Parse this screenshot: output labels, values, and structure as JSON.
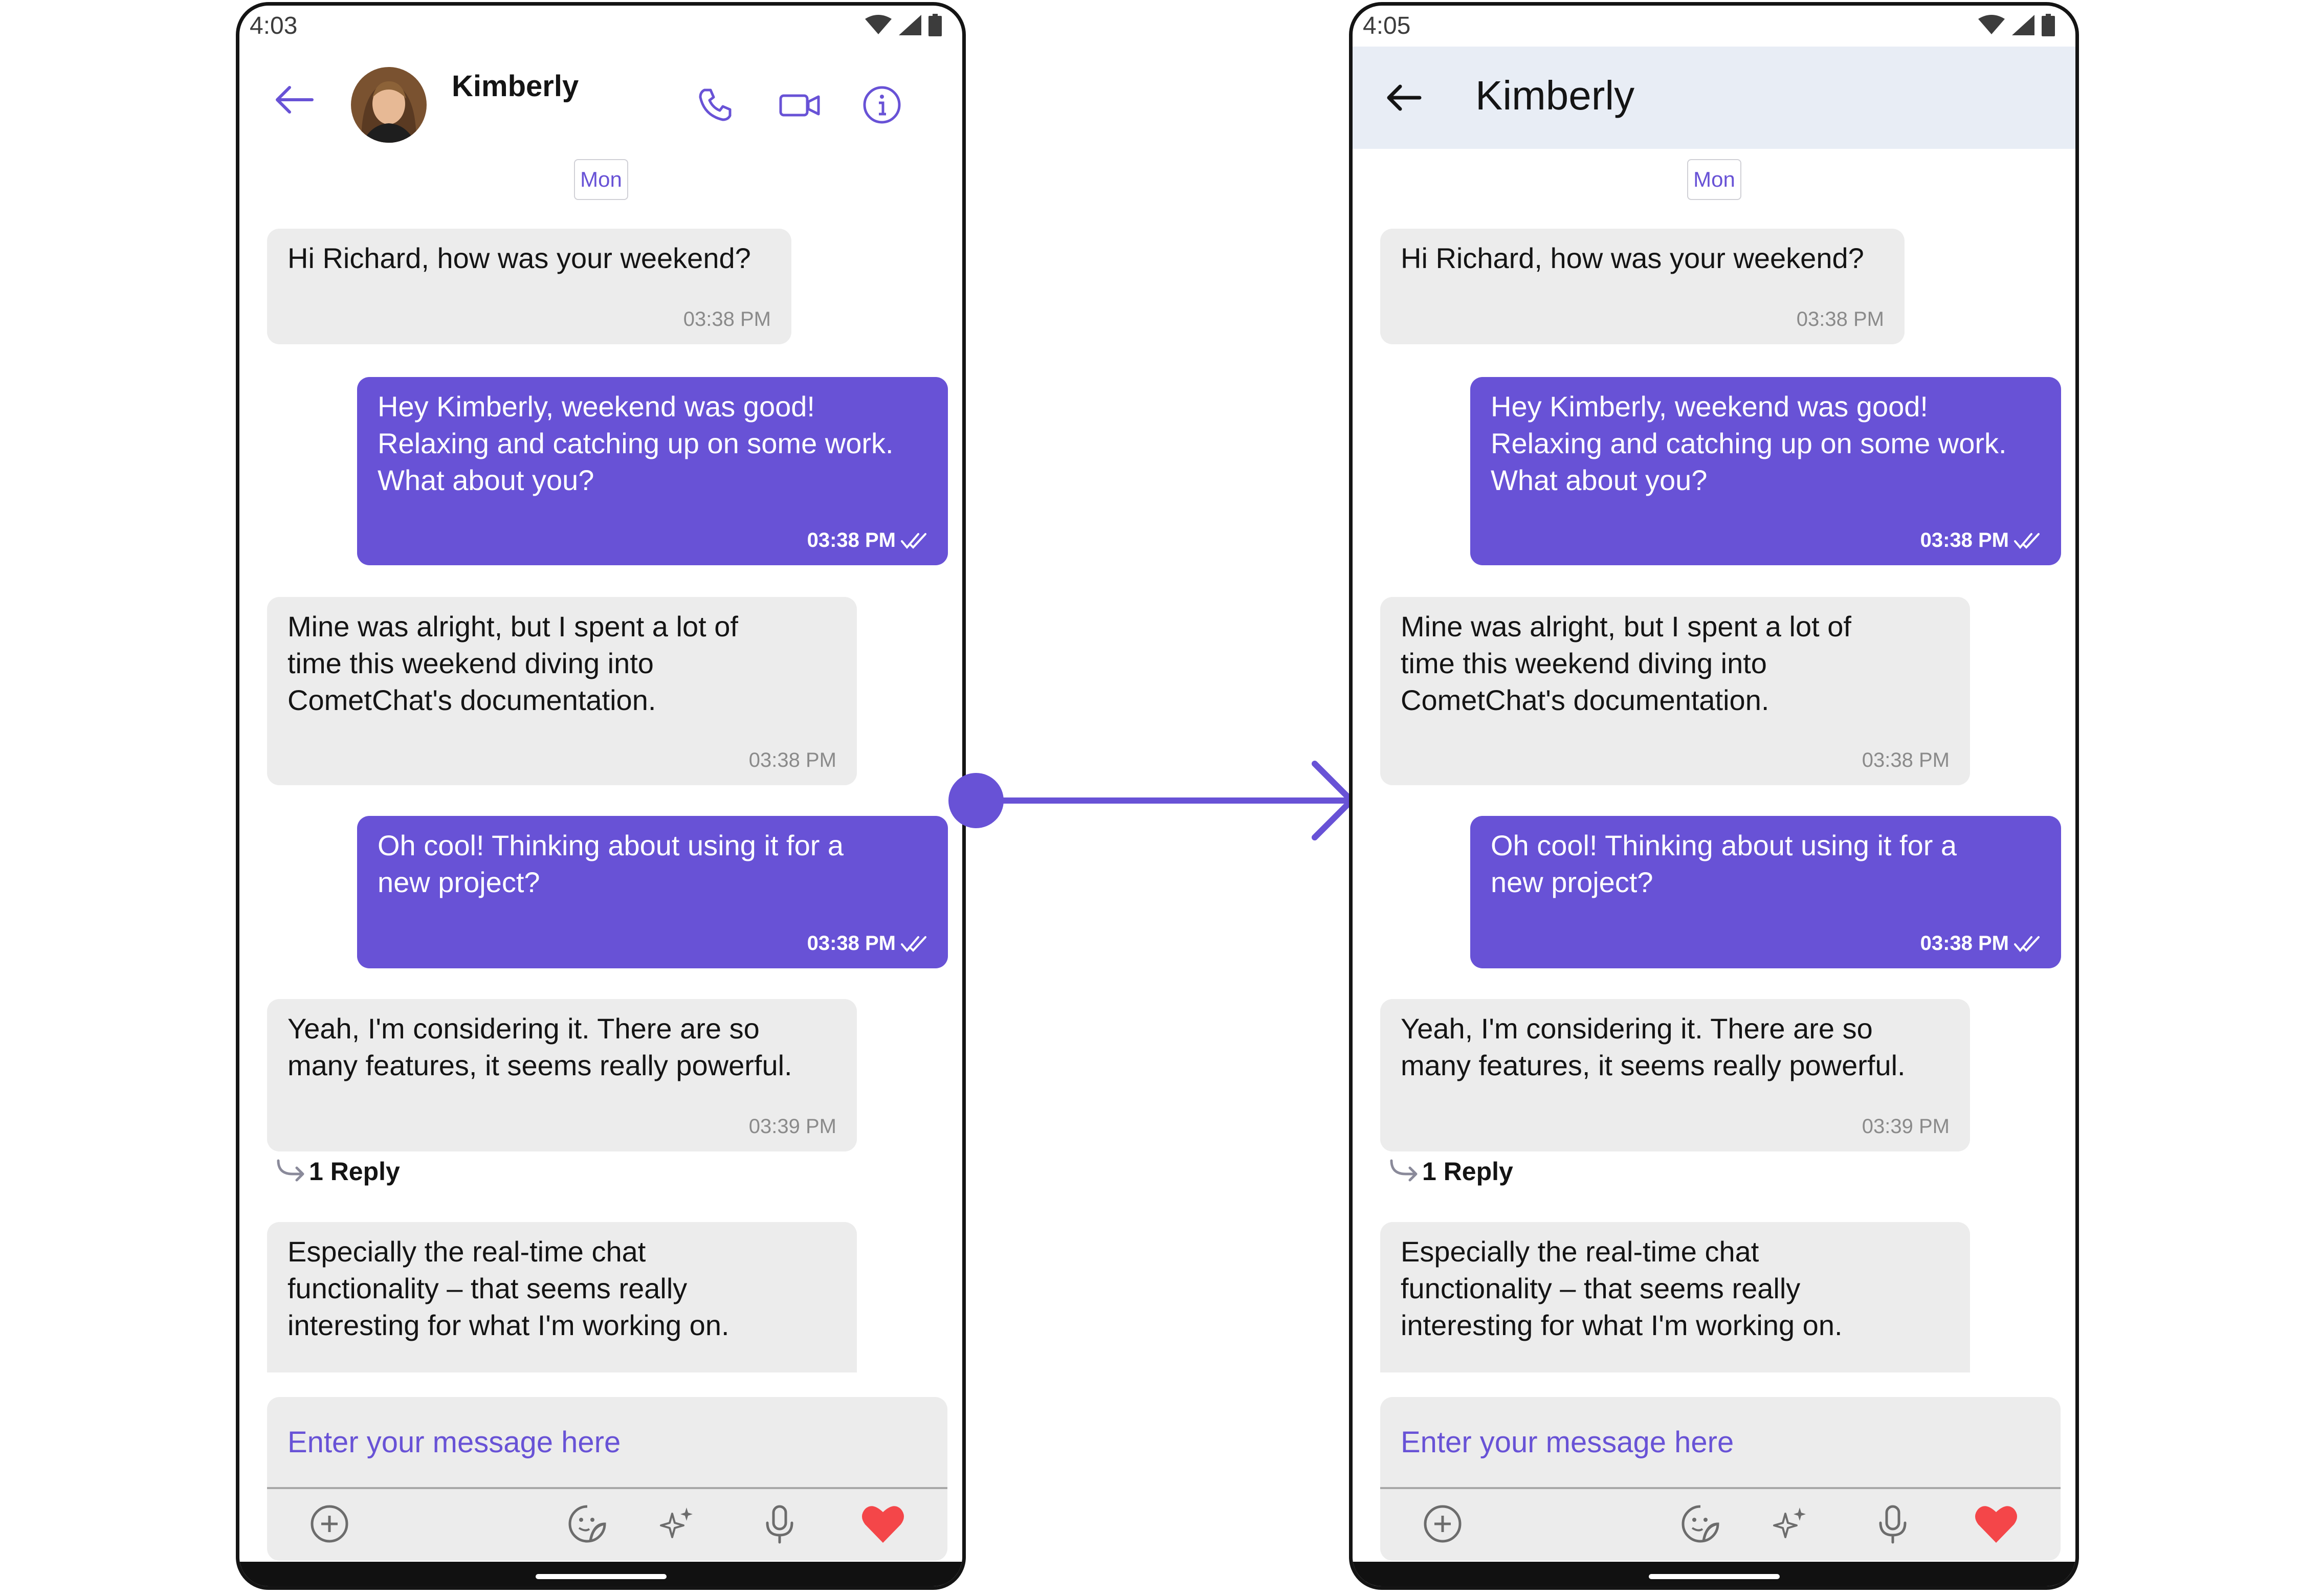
{
  "colors": {
    "accent": "#6852d6",
    "incoming_bubble": "#ececec",
    "header_right_bg": "#e8edf5",
    "heart": "#f44649"
  },
  "screens": [
    {
      "status_time": "4:03",
      "header_name": "Kimberly"
    },
    {
      "status_time": "4:05",
      "header_name": "Kimberly"
    }
  ],
  "date_separator": "Mon",
  "messages": [
    {
      "direction": "in",
      "text": "Hi Richard, how was your weekend?",
      "time": "03:38 PM"
    },
    {
      "direction": "out",
      "text": "Hey Kimberly, weekend was good!\nRelaxing and catching up on some work.\nWhat about you?",
      "time": "03:38 PM"
    },
    {
      "direction": "in",
      "text": "Mine was alright, but I spent a lot of\ntime this weekend diving into\nCometChat's documentation.",
      "time": "03:38 PM"
    },
    {
      "direction": "out",
      "text": "Oh cool! Thinking about using it for a\nnew project?",
      "time": "03:38 PM"
    },
    {
      "direction": "in",
      "text": "Yeah, I'm considering it.  There are so\nmany features, it seems really powerful.",
      "time": "03:39 PM"
    },
    {
      "direction": "in",
      "text": "Especially the real-time chat\nfunctionality – that seems really\ninteresting for what I'm working on.",
      "time": ""
    }
  ],
  "reply_label": "1 Reply",
  "composer": {
    "placeholder": "Enter your message here"
  },
  "icons": {
    "header_left": [
      "back-arrow-icon",
      "voice-call-icon",
      "video-call-icon",
      "info-icon"
    ],
    "header_right": [
      "back-arrow-icon"
    ],
    "composer": [
      "add-attachment-icon",
      "sticker-icon",
      "ai-sparkle-icon",
      "microphone-icon",
      "heart-icon"
    ],
    "read_receipt": "double-check-icon"
  }
}
